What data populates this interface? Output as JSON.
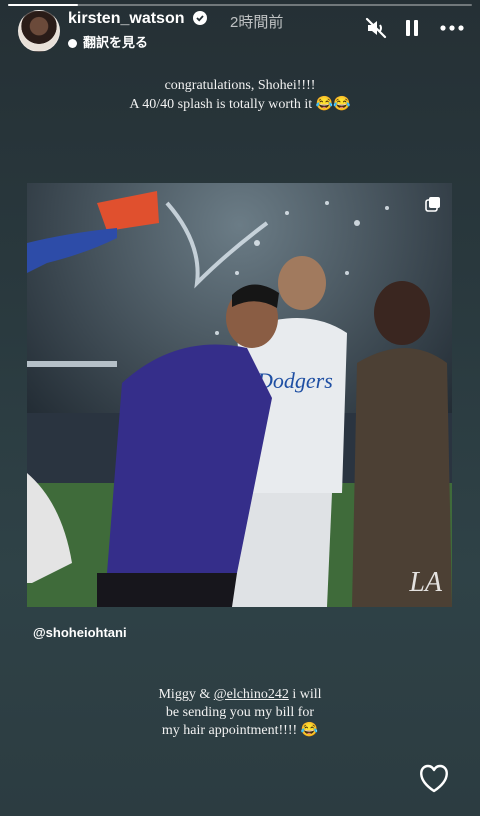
{
  "story": {
    "progress": 0.15,
    "username": "kirsten_watson",
    "time": "2時間前",
    "translate_label": "翻訳を見る",
    "caption_top": "congratulations, Shohei!!!!\nA 40/40 splash is totally worth it 😂😂",
    "media_mention": "@shoheiohtani",
    "caption_bottom": {
      "part1": "Miggy & ",
      "mention": "@elchino242",
      "part2": " i will\nbe sending you my bill for\nmy hair appointment!!!! 😂"
    },
    "logo": "LA",
    "icons": {
      "mute": "speaker-muted-icon",
      "pause": "pause-icon",
      "more": "more-dots-icon",
      "heart": "heart-icon",
      "verified": "verified-badge-icon",
      "carousel": "carousel-icon"
    }
  }
}
